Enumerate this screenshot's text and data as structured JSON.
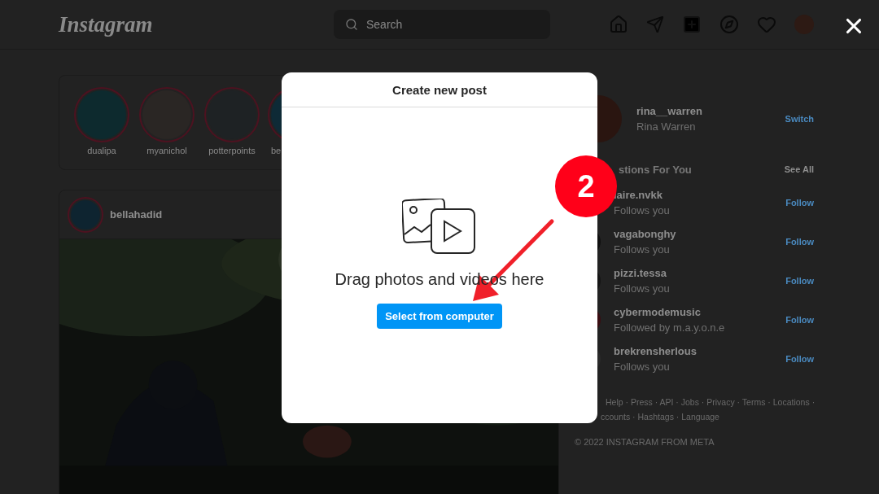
{
  "header": {
    "logo": "Instagram",
    "search": {
      "placeholder": "Search"
    }
  },
  "stories": [
    {
      "username": "dualipa"
    },
    {
      "username": "myanichol"
    },
    {
      "username": "potterpoints"
    },
    {
      "username": "be"
    }
  ],
  "post": {
    "username": "bellahadid"
  },
  "profile": {
    "username": "rina__warren",
    "name": "Rina Warren",
    "action": "Switch"
  },
  "suggestions": {
    "title": "stions For You",
    "see_all": "See All",
    "items": [
      {
        "username": "laire.nvkk",
        "subtitle": "Follows you",
        "action": "Follow"
      },
      {
        "username": "vagabonghy",
        "subtitle": "Follows you",
        "action": "Follow"
      },
      {
        "username": "pizzi.tessa",
        "subtitle": "Follows you",
        "action": "Follow"
      },
      {
        "username": "cybermodemusic",
        "subtitle": "Followed by m.a.y.o.n.e",
        "action": "Follow"
      },
      {
        "username": "brekrensherlous",
        "subtitle": "Follows you",
        "action": "Follow"
      }
    ]
  },
  "footer": {
    "links": [
      "Help · Press · API · Jobs · Privacy · Terms · Locations ·",
      "ccounts · Hashtags · Language"
    ],
    "copyright": "© 2022 INSTAGRAM FROM META"
  },
  "modal": {
    "title": "Create new post",
    "message": "Drag photos and videos here",
    "button": "Select from computer"
  },
  "annotation": {
    "step": "2"
  }
}
